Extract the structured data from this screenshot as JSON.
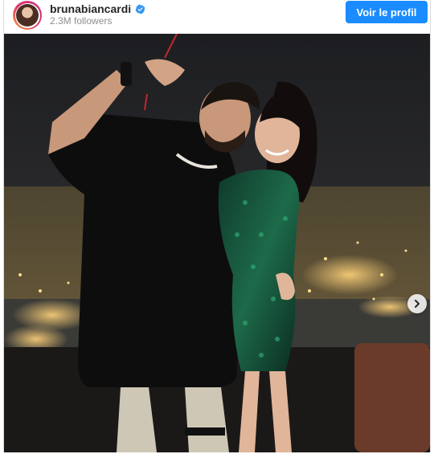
{
  "post_header": {
    "username": "brunabiancardi",
    "verified_icon": "verified-badge-icon",
    "followers": "2.3M followers",
    "profile_button": "Voir le profil"
  },
  "photo": {
    "description_icon": "photo",
    "next_icon": "chevron-right-icon"
  },
  "colors": {
    "button": "#1a8cff",
    "verified": "#3897f0"
  }
}
